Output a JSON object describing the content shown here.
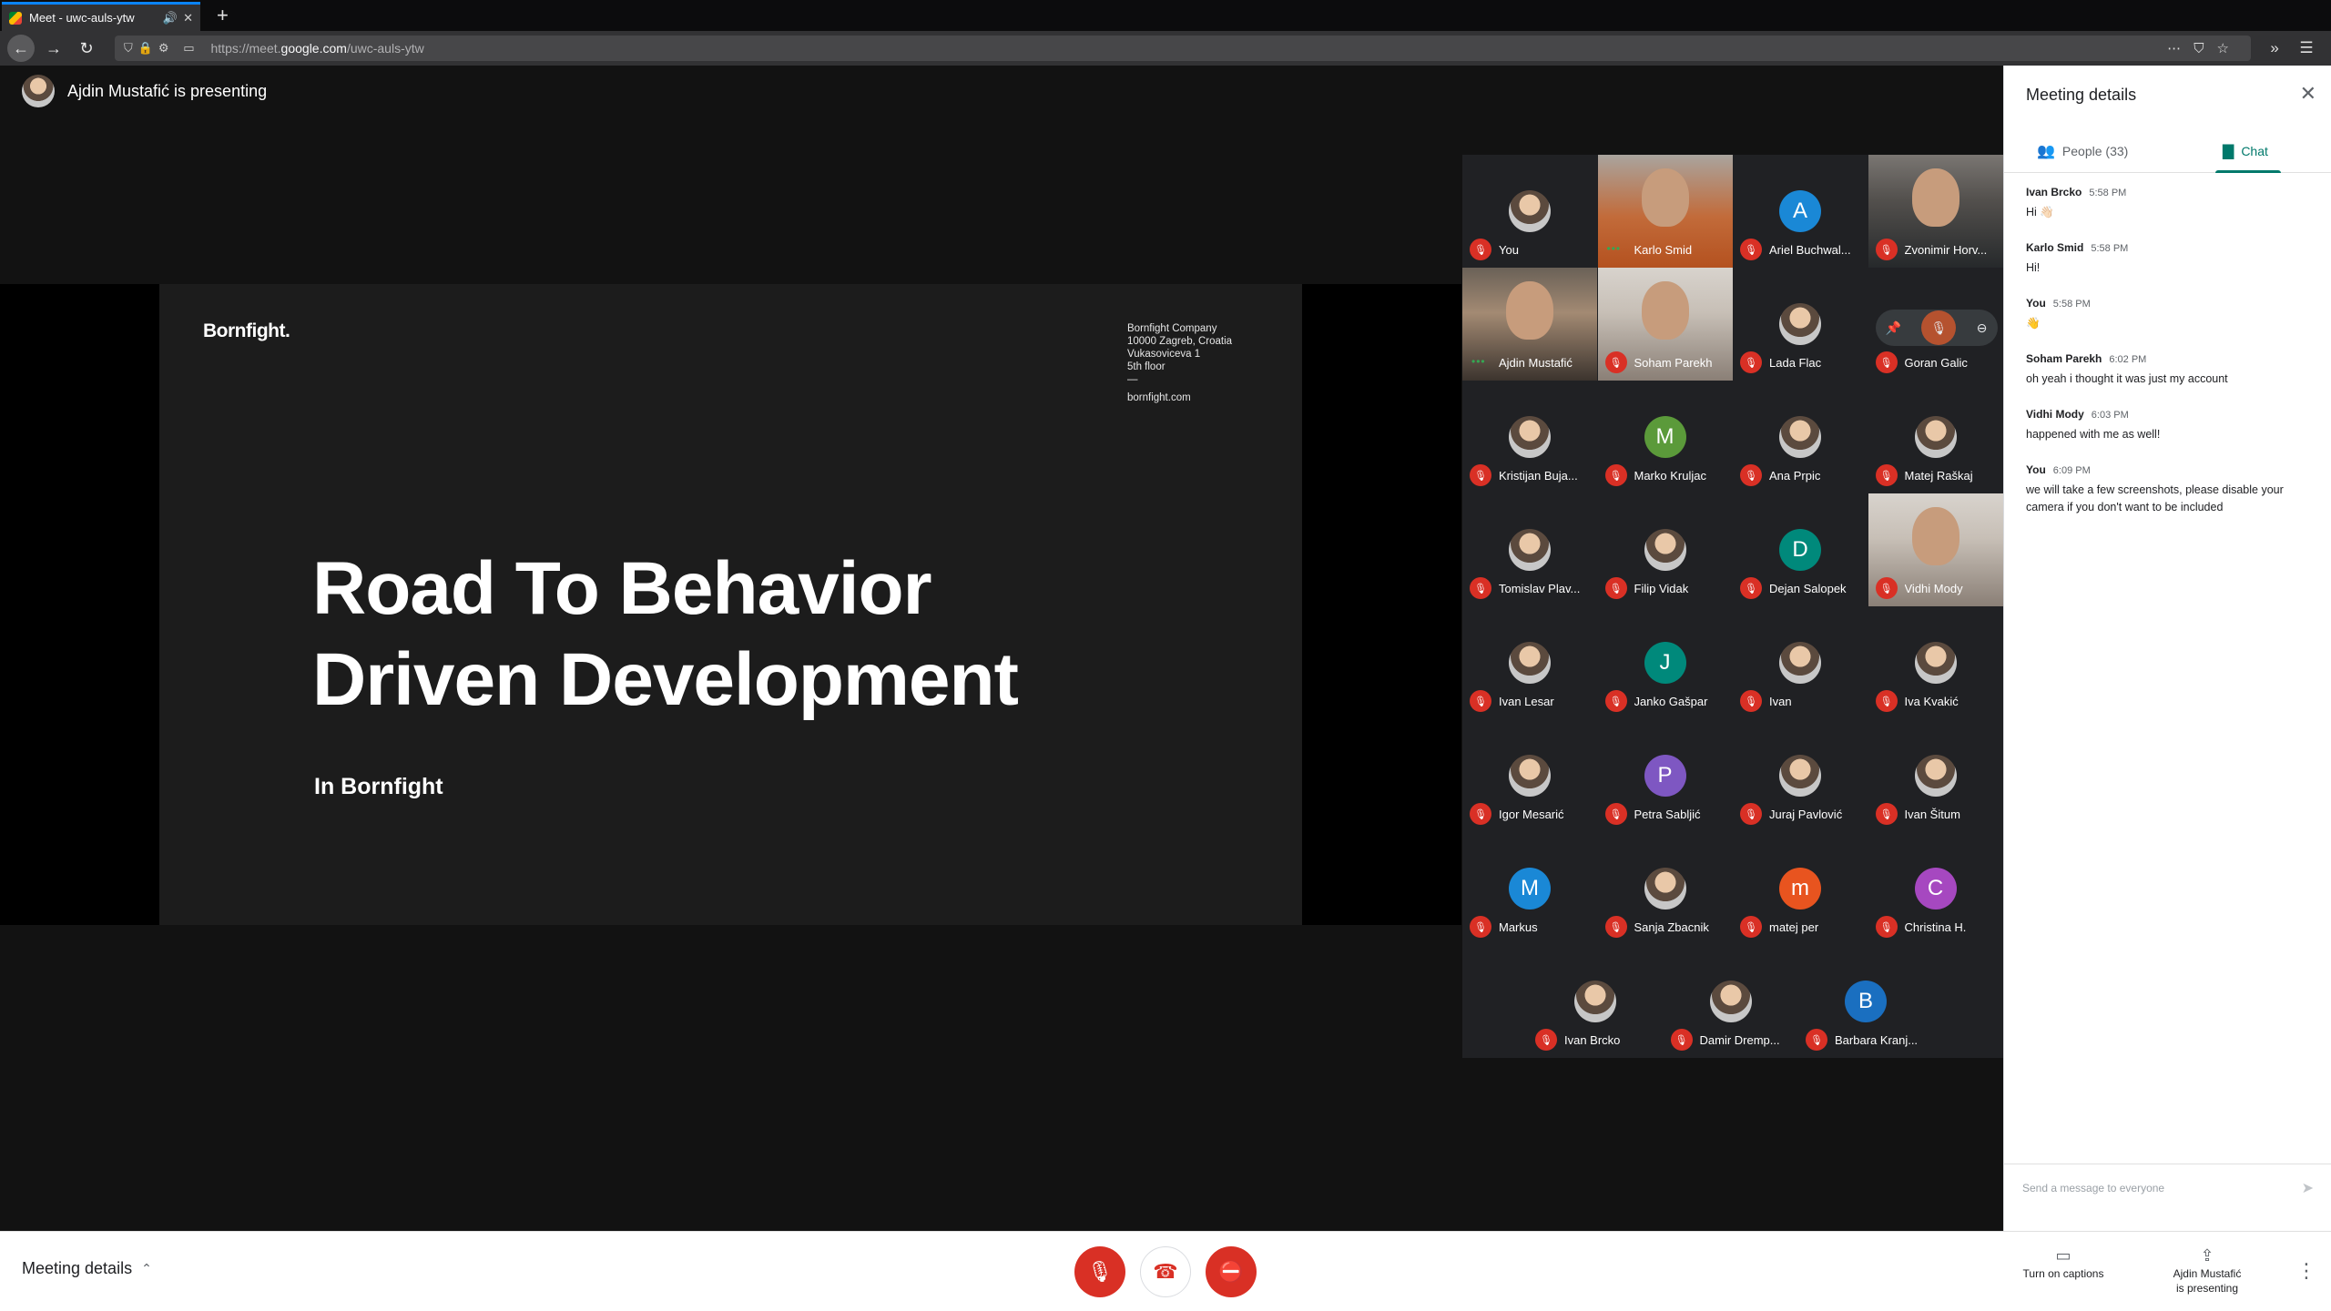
{
  "browser": {
    "tab_title": "Meet - uwc-auls-ytw",
    "url_prefix": "https://meet.",
    "url_host": "google.com",
    "url_path": "/uwc-auls-ytw"
  },
  "stage": {
    "presenting_text": "Ajdin Mustafić is presenting"
  },
  "slide": {
    "logo": "Bornfight.",
    "address_lines": [
      "Bornfight Company",
      "10000 Zagreb, Croatia",
      "Vukasoviceva 1",
      "5th floor",
      "—"
    ],
    "site": "bornfight.com",
    "headline_1": "Road To Behavior",
    "headline_2": "Driven Development",
    "sub": "In Bornfight"
  },
  "participants": [
    {
      "name": "You",
      "kind": "photo"
    },
    {
      "name": "Karlo Smid",
      "kind": "video",
      "style": "orange",
      "speaking": true
    },
    {
      "name": "Ariel Buchwal...",
      "kind": "letter",
      "letter": "A",
      "color": "#1a88d6"
    },
    {
      "name": "Zvonimir Horv...",
      "kind": "video",
      "style": "dark"
    },
    {
      "name": "Ajdin Mustafić",
      "kind": "video",
      "style": "",
      "speaking": true
    },
    {
      "name": "Soham Parekh",
      "kind": "video",
      "style": "light"
    },
    {
      "name": "Lada Flac",
      "kind": "photo"
    },
    {
      "name": "Goran Galic",
      "kind": "hover"
    },
    {
      "name": "Kristijan Buja...",
      "kind": "photo"
    },
    {
      "name": "Marko Kruljac",
      "kind": "letter",
      "letter": "M",
      "color": "#5b9a3a"
    },
    {
      "name": "Ana Prpic",
      "kind": "photo"
    },
    {
      "name": "Matej Raškaj",
      "kind": "photo"
    },
    {
      "name": "Tomislav Plav...",
      "kind": "photo"
    },
    {
      "name": "Filip Vidak",
      "kind": "photo"
    },
    {
      "name": "Dejan Salopek",
      "kind": "letter",
      "letter": "D",
      "color": "#00897b"
    },
    {
      "name": "Vidhi Mody",
      "kind": "video",
      "style": "light"
    },
    {
      "name": "Ivan Lesar",
      "kind": "photo"
    },
    {
      "name": "Janko Gašpar",
      "kind": "letter",
      "letter": "J",
      "color": "#00897b"
    },
    {
      "name": "Ivan",
      "kind": "photo"
    },
    {
      "name": "Iva Kvakić",
      "kind": "photo"
    },
    {
      "name": "Igor Mesarić",
      "kind": "photo"
    },
    {
      "name": "Petra Sabljić",
      "kind": "letter",
      "letter": "P",
      "color": "#7e57c2"
    },
    {
      "name": "Juraj Pavlović",
      "kind": "photo"
    },
    {
      "name": "Ivan Šitum",
      "kind": "photo"
    },
    {
      "name": "Markus",
      "kind": "letter",
      "letter": "M",
      "color": "#1a88d6"
    },
    {
      "name": "Sanja Zbacnik",
      "kind": "photo"
    },
    {
      "name": "matej per",
      "kind": "letter",
      "letter": "m",
      "color": "#e8541f"
    },
    {
      "name": "Christina H.",
      "kind": "letter",
      "letter": "C",
      "color": "#a648c0"
    },
    {
      "name": "Ivan Brcko",
      "kind": "photo"
    },
    {
      "name": "Damir Dremp...",
      "kind": "photo"
    },
    {
      "name": "Barbara Kranj...",
      "kind": "letter",
      "letter": "B",
      "color": "#1a6fc0"
    }
  ],
  "panel": {
    "title": "Meeting details",
    "people_tab": "People (33)",
    "chat_tab": "Chat",
    "messages": [
      {
        "sender": "Ivan Brcko",
        "time": "5:58 PM",
        "text": "Hi 👋🏻"
      },
      {
        "sender": "Karlo Smid",
        "time": "5:58 PM",
        "text": "Hi!"
      },
      {
        "sender": "You",
        "time": "5:58 PM",
        "text": "👋"
      },
      {
        "sender": "Soham Parekh",
        "time": "6:02 PM",
        "text": "oh yeah i thought it was just my account"
      },
      {
        "sender": "Vidhi Mody",
        "time": "6:03 PM",
        "text": "happened with me as well!"
      },
      {
        "sender": "You",
        "time": "6:09 PM",
        "text": "we will take a few screenshots, please disable your camera if you don't want to be included"
      }
    ],
    "composer_placeholder": "Send a message to everyone"
  },
  "bottombar": {
    "meeting_details": "Meeting details",
    "captions": "Turn on captions",
    "present_1": "Ajdin Mustafić",
    "present_2": "is presenting"
  },
  "colors": {
    "mute_red": "#d93025",
    "chat_accent": "#00796b"
  }
}
